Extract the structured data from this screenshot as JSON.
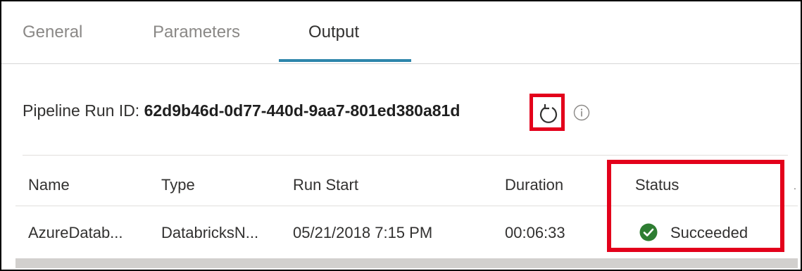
{
  "tabs": [
    {
      "label": "General",
      "active": false
    },
    {
      "label": "Parameters",
      "active": false
    },
    {
      "label": "Output",
      "active": true
    }
  ],
  "run": {
    "label": "Pipeline Run ID:",
    "id": "62d9b46d-0d77-440d-9aa7-801ed380a81d",
    "refresh_icon": "refresh-icon",
    "info_icon": "info-icon"
  },
  "table": {
    "columns": [
      "Name",
      "Type",
      "Run Start",
      "Duration",
      "Status"
    ],
    "rows": [
      {
        "name": "AzureDatab...",
        "type": "DatabricksN...",
        "run_start": "05/21/2018 7:15 PM",
        "duration": "00:06:33",
        "status": "Succeeded",
        "status_icon": "check-circle-icon"
      }
    ]
  },
  "colors": {
    "accent": "#2e86ab",
    "highlight": "#e3001b",
    "success": "#2e7d32"
  }
}
